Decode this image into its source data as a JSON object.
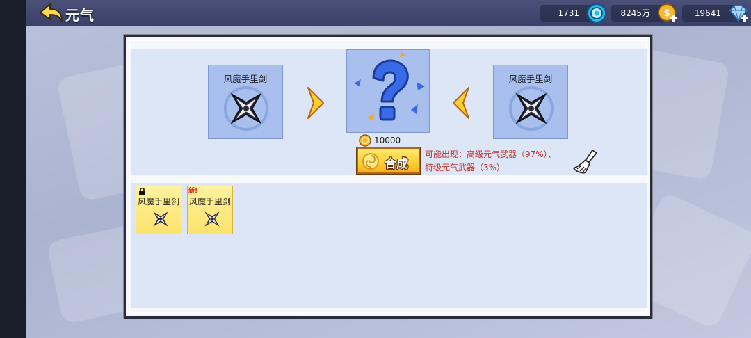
{
  "header": {
    "title": "元气",
    "back_icon": "back-arrow-icon"
  },
  "resources": [
    {
      "name": "gems",
      "value": "1731",
      "icon": "blue-gem-icon"
    },
    {
      "name": "coins",
      "value": "8245万",
      "icon": "gold-coin-plus-icon"
    },
    {
      "name": "diamonds",
      "value": "19641",
      "icon": "diamond-plus-icon"
    }
  ],
  "merge": {
    "left_slot": {
      "name": "风魔手里剑"
    },
    "result_slot": {
      "icon": "question-mark-icon"
    },
    "right_slot": {
      "name": "风魔手里剑"
    },
    "cost": "10000",
    "button_label": "合成",
    "chance_line1": "可能出现：高级元气武器（97%）、",
    "chance_line2": "特级元气武器（3%）"
  },
  "inventory": [
    {
      "name": "风魔手里剑",
      "badge": "lock"
    },
    {
      "name": "风魔手里剑",
      "badge": "新!"
    }
  ],
  "colors": {
    "accent_gold": "#ffcf2d",
    "chance_red": "#c0322a",
    "slot_blue": "#a9c0ee"
  }
}
